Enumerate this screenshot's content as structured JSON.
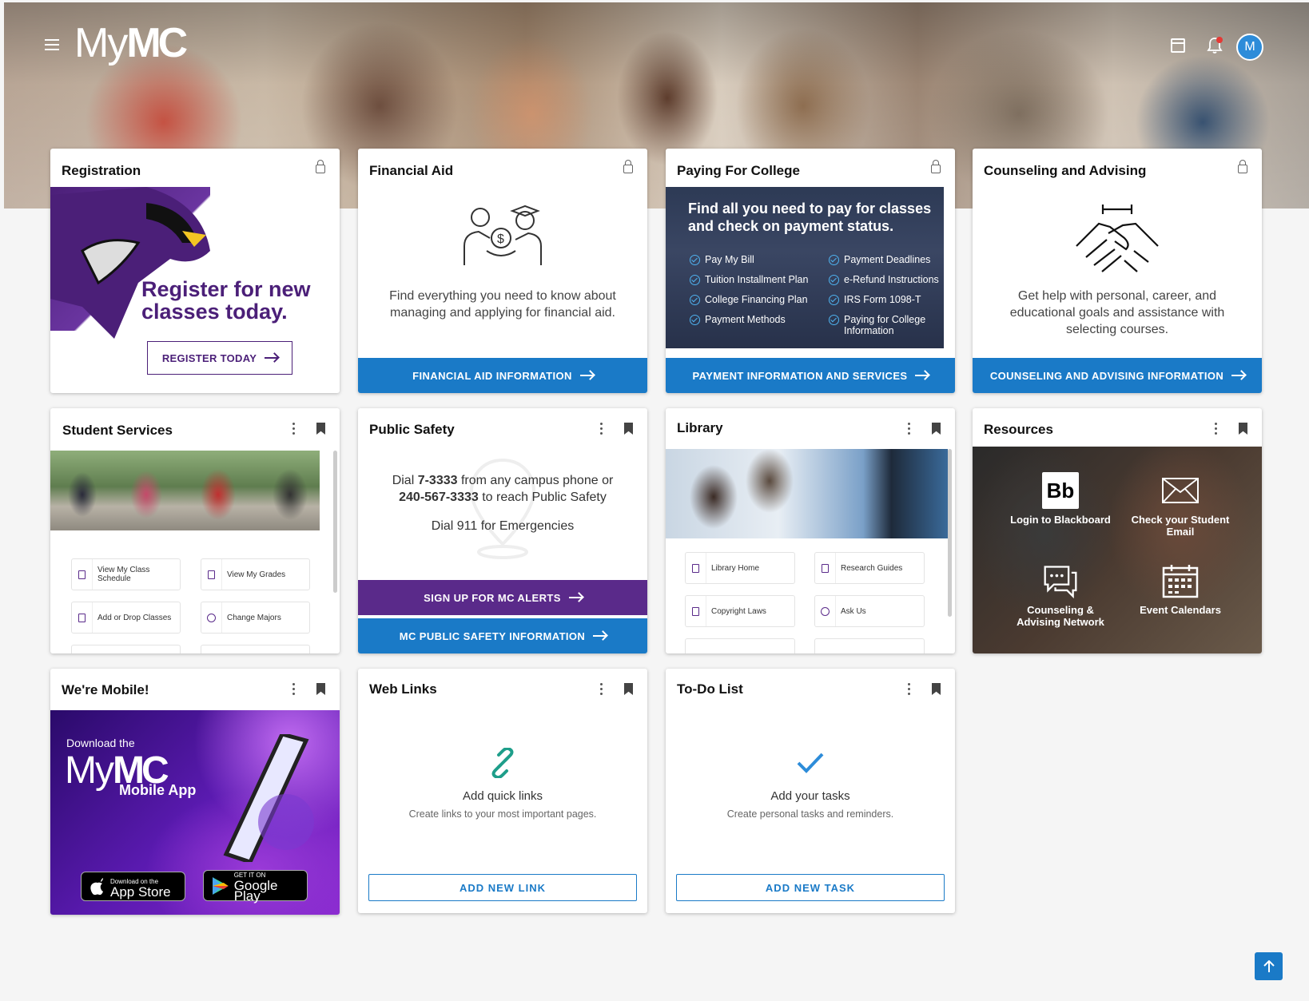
{
  "header": {
    "logo_light": "My",
    "logo_bold": "MC",
    "avatar_initial": "M",
    "icons": [
      "menu-icon",
      "calendar-icon",
      "bell-icon"
    ]
  },
  "colors": {
    "primary_blue": "#1a7ac7",
    "brand_purple": "#5a2a8a",
    "notification_red": "#e53935"
  },
  "cards": {
    "registration": {
      "title": "Registration",
      "banner_text": "Register for new classes today.",
      "button": "REGISTER TODAY"
    },
    "financial_aid": {
      "title": "Financial Aid",
      "description": "Find everything you need to know about managing and applying for financial aid.",
      "button": "FINANCIAL AID INFORMATION"
    },
    "paying": {
      "title": "Paying For College",
      "headline": "Find all you need to pay for classes and check on payment status.",
      "items": [
        "Pay My Bill",
        "Payment Deadlines",
        "Tuition Installment Plan",
        "e-Refund Instructions",
        "College Financing Plan",
        "IRS Form 1098-T",
        "Payment Methods",
        "Paying for College Information"
      ],
      "button": "PAYMENT INFORMATION AND SERVICES"
    },
    "counseling": {
      "title": "Counseling and Advising",
      "description": "Get help with personal, career, and educational goals and assistance with selecting courses.",
      "button": "COUNSELING AND ADVISING INFORMATION"
    },
    "student_services": {
      "title": "Student Services",
      "links": [
        "View My Class Schedule",
        "View My Grades",
        "Add or Drop Classes",
        "Change Majors"
      ]
    },
    "public_safety": {
      "title": "Public Safety",
      "dial_prefix": "Dial ",
      "campus_number": "7-3333",
      "dial_mid": " from any campus phone or",
      "public_number": "240-567-3333",
      "dial_suffix": " to reach Public Safety",
      "emergency": "Dial 911 for Emergencies",
      "alerts_button": "SIGN UP FOR MC ALERTS",
      "info_button": "MC PUBLIC SAFETY INFORMATION"
    },
    "library": {
      "title": "Library",
      "links": [
        "Library Home",
        "Research Guides",
        "Copyright Laws",
        "Ask Us"
      ]
    },
    "resources": {
      "title": "Resources",
      "items": [
        {
          "label": "Login to Blackboard",
          "icon": "blackboard-icon",
          "icon_text": "Bb"
        },
        {
          "label": "Check your Student Email",
          "icon": "envelope-icon"
        },
        {
          "label": "Counseling & Advising Network",
          "icon": "chat-bubbles-icon"
        },
        {
          "label": "Event Calendars",
          "icon": "calendar-grid-icon"
        }
      ]
    },
    "mobile": {
      "title": "We're Mobile!",
      "download_text": "Download the",
      "logo_light": "My",
      "logo_bold": "MC",
      "app_text": "Mobile App",
      "appstore_small": "Download on the",
      "appstore_big": "App Store",
      "googleplay_small": "GET IT ON",
      "googleplay_big": "Google Play"
    },
    "web_links": {
      "title": "Web Links",
      "empty_title": "Add quick links",
      "empty_sub": "Create links to your most important pages.",
      "button": "ADD NEW LINK"
    },
    "todo": {
      "title": "To-Do List",
      "empty_title": "Add your tasks",
      "empty_sub": "Create personal tasks and reminders.",
      "button": "ADD NEW TASK"
    }
  }
}
